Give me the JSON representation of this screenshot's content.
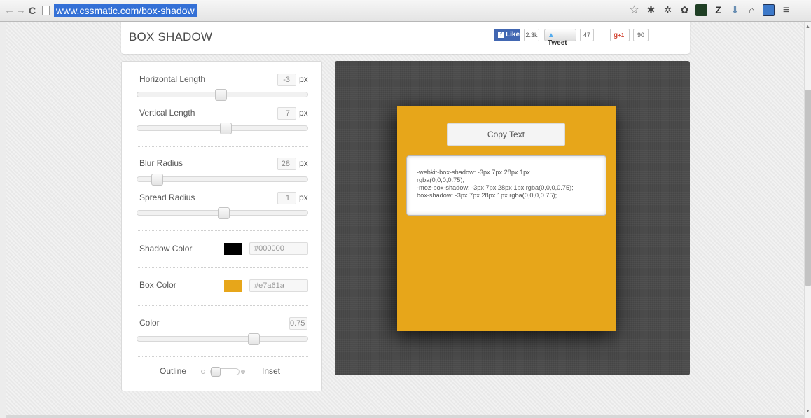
{
  "browser": {
    "url": "www.cssmatic.com/box-shadow",
    "nav": {
      "back": "←",
      "forward": "→",
      "reload": "C"
    },
    "extensions": [
      {
        "name": "star-bookmark-icon",
        "glyph": "☆"
      },
      {
        "name": "extension-1-icon",
        "glyph": "✱"
      },
      {
        "name": "extension-2-icon",
        "glyph": "✲"
      },
      {
        "name": "extension-3-icon",
        "glyph": "✿"
      },
      {
        "name": "extension-4-icon",
        "glyph": ""
      },
      {
        "name": "extension-z-icon",
        "glyph": "Z"
      },
      {
        "name": "extension-6-icon",
        "glyph": "⬇"
      },
      {
        "name": "extension-7-icon",
        "glyph": "⌂"
      },
      {
        "name": "extension-8-icon",
        "glyph": ""
      }
    ],
    "menu_glyph": "≡"
  },
  "header": {
    "title": "BOX SHADOW",
    "social": {
      "like_label": "Like",
      "like_count": "2.3k",
      "tweet_label": "Tweet",
      "tweet_count": "47",
      "gplus_label": "+1",
      "gplus_count": "90"
    }
  },
  "controls": {
    "horizontal": {
      "label": "Horizontal Length",
      "value": "-3",
      "unit": "px",
      "level": 0.49
    },
    "vertical": {
      "label": "Vertical Length",
      "value": "7",
      "unit": "px",
      "level": 0.52
    },
    "blur": {
      "label": "Blur Radius",
      "value": "28",
      "unit": "px",
      "level": 0.09
    },
    "spread": {
      "label": "Spread Radius",
      "value": "1",
      "unit": "px",
      "level": 0.51
    },
    "shadow_color": {
      "label": "Shadow Color",
      "hex": "#000000",
      "color": "#000000"
    },
    "box_color": {
      "label": "Box Color",
      "hex": "#e7a61a",
      "color": "#e7a61a"
    },
    "opacity": {
      "label": "Color",
      "value": "0.75",
      "level": 0.7
    },
    "toggle": {
      "outline_label": "Outline",
      "inset_label": "Inset",
      "state": "outline"
    }
  },
  "preview": {
    "copy_label": "Copy Text",
    "code_lines": [
      "-webkit-box-shadow: -3px 7px 28px 1px",
      "rgba(0,0,0,0.75);",
      "-moz-box-shadow: -3px 7px 28px 1px rgba(0,0,0,0.75);",
      "box-shadow: -3px 7px 28px 1px rgba(0,0,0,0.75);"
    ]
  }
}
